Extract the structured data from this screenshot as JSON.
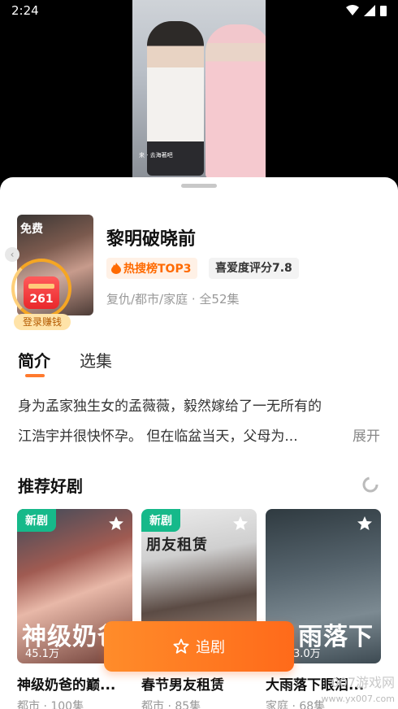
{
  "status": {
    "time": "2:24"
  },
  "video": {
    "caption": "来 · 去海著吧"
  },
  "drama": {
    "cover_badge": "免费",
    "title": "黎明破晓前",
    "hot_tag": "热搜榜TOP3",
    "rating": "喜爱度评分7.8",
    "meta": "复仇/都市/家庭 · 全52集",
    "coin_count": "261",
    "login_label": "登录赚钱"
  },
  "tabs": {
    "intro": "简介",
    "episodes": "选集"
  },
  "description": {
    "line1": "身为孟家独生女的孟薇薇，毅然嫁给了一无所有的",
    "line2": "江浩宇并很快怀孕。 但在临盆当天，父母为...",
    "expand": "展开"
  },
  "recommend": {
    "title": "推荐好剧",
    "cards": [
      {
        "badge": "新剧",
        "cover_text": "神级奶爸",
        "views": "45.1万",
        "title": "神级奶爸的巅...",
        "meta": "都市 · 100集"
      },
      {
        "badge": "新剧",
        "cover_text": "朋友租赁",
        "views": "",
        "title": "春节男友租赁",
        "meta": "都市 · 85集"
      },
      {
        "badge": "",
        "cover_text": "雨落下",
        "views": "3.0万",
        "title": "大雨落下眼泪...",
        "meta": "家庭 · 68集"
      }
    ]
  },
  "follow_button": "追剧",
  "watermark": {
    "main": "007游戏网",
    "url": "www.yx007.com"
  },
  "colors": {
    "accent": "#ff7a2e",
    "new_badge": "#16b98a"
  }
}
